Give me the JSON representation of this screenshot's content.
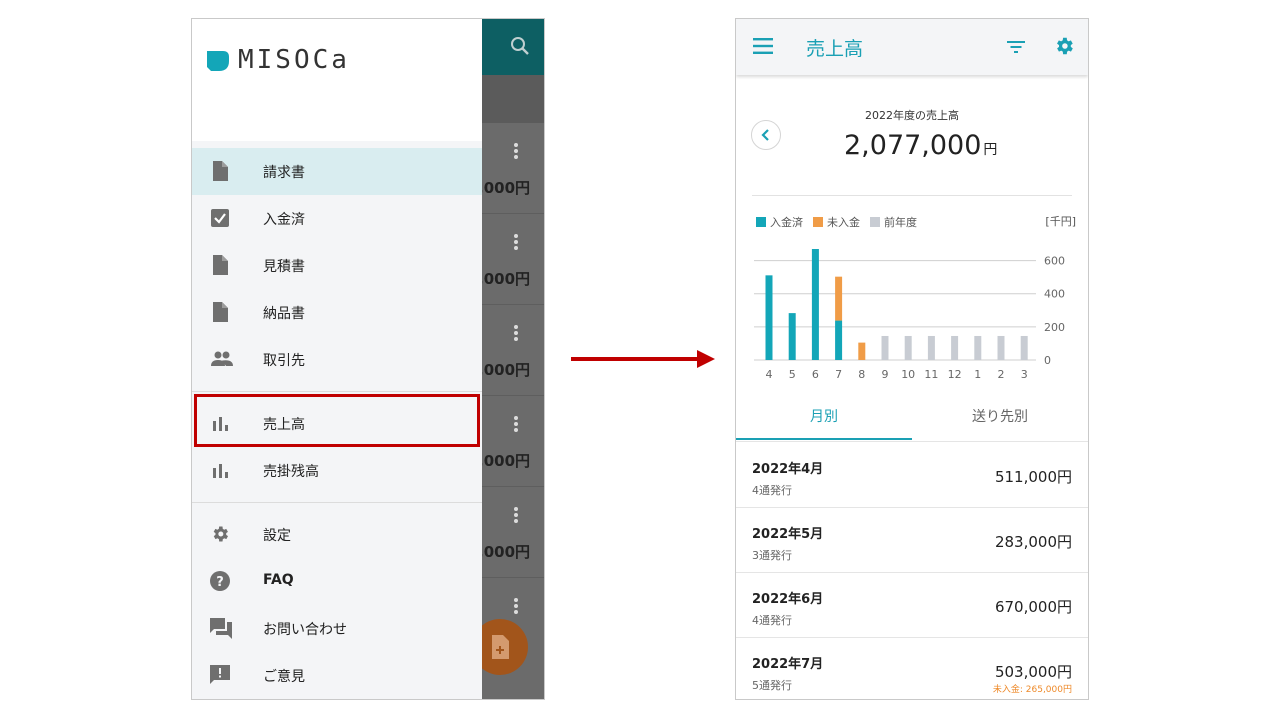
{
  "drawer": {
    "logo_text": "MISOCa",
    "items": [
      {
        "label": "請求書",
        "icon": "document-icon",
        "active": true
      },
      {
        "label": "入金済",
        "icon": "checkbox-icon"
      },
      {
        "label": "見積書",
        "icon": "document-icon"
      },
      {
        "label": "納品書",
        "icon": "document-icon"
      },
      {
        "label": "取引先",
        "icon": "people-icon"
      },
      {
        "label": "売上高",
        "icon": "bar-chart-icon",
        "highlighted": true
      },
      {
        "label": "売掛残高",
        "icon": "bar-chart-icon"
      },
      {
        "label": "設定",
        "icon": "gear-icon"
      },
      {
        "label": "FAQ",
        "icon": "help-icon"
      },
      {
        "label": "お問い合わせ",
        "icon": "chat-icon"
      },
      {
        "label": "ご意見",
        "icon": "feedback-icon"
      }
    ]
  },
  "background_list": {
    "amounts": [
      ",000円",
      ",000円",
      ",000円",
      ",000円",
      ",000円"
    ]
  },
  "sales": {
    "app_title": "売上高",
    "subtitle": "2022年度の売上高",
    "total": "2,077,000",
    "total_unit": "円",
    "tabs": [
      "月別",
      "送り先別"
    ],
    "rows": [
      {
        "month": "2022年4月",
        "count": "4通発行",
        "amount": "511,000円",
        "note": ""
      },
      {
        "month": "2022年5月",
        "count": "3通発行",
        "amount": "283,000円",
        "note": ""
      },
      {
        "month": "2022年6月",
        "count": "4通発行",
        "amount": "670,000円",
        "note": ""
      },
      {
        "month": "2022年7月",
        "count": "5通発行",
        "amount": "503,000円",
        "note": "未入金: 265,000円"
      }
    ]
  },
  "colors": {
    "accent": "#1aa0b4",
    "paid": "#13a6b8",
    "unpaid": "#f09c47",
    "prev_year": "#c8ccd3",
    "highlight": "#c00000"
  },
  "chart_data": {
    "type": "bar",
    "unit_label": "[千円]",
    "legend": [
      "入金済",
      "未入金",
      "前年度"
    ],
    "categories": [
      "4",
      "5",
      "6",
      "7",
      "8",
      "9",
      "10",
      "11",
      "12",
      "1",
      "2",
      "3"
    ],
    "series": [
      {
        "name": "入金済",
        "values": [
          511,
          283,
          670,
          238,
          0,
          0,
          0,
          0,
          0,
          0,
          0,
          0
        ]
      },
      {
        "name": "未入金",
        "values": [
          0,
          0,
          0,
          265,
          105,
          0,
          0,
          0,
          0,
          0,
          0,
          0
        ]
      },
      {
        "name": "前年度",
        "values": [
          0,
          0,
          0,
          0,
          0,
          145,
          145,
          145,
          145,
          145,
          145,
          145
        ]
      }
    ],
    "yticks": [
      0,
      200,
      400,
      600
    ],
    "ylim": [
      0,
      670
    ]
  }
}
